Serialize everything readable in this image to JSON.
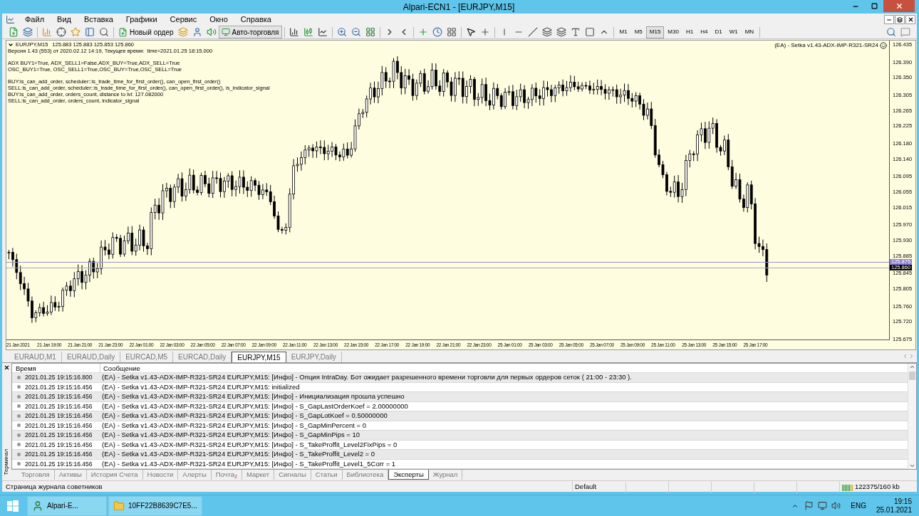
{
  "window": {
    "title": "Alpari-ECN1 - [EURJPY,M15]"
  },
  "menu": [
    "Файл",
    "Вид",
    "Вставка",
    "Графики",
    "Сервис",
    "Окно",
    "Справка"
  ],
  "toolbar": {
    "new_order": "Новый ордер",
    "auto_trading": "Авто-торговля",
    "timeframes": [
      {
        "label": "M1",
        "selected": false
      },
      {
        "label": "M5",
        "selected": false
      },
      {
        "label": "M15",
        "selected": true
      },
      {
        "label": "M30",
        "selected": false
      },
      {
        "label": "H1",
        "selected": false
      },
      {
        "label": "H4",
        "selected": false
      },
      {
        "label": "D1",
        "selected": false
      },
      {
        "label": "W1",
        "selected": false
      },
      {
        "label": "MN",
        "selected": false
      }
    ]
  },
  "chart": {
    "symbol": "EURJPY,M15",
    "ohlc": "125.883 125.883 125.853 125.860",
    "info_groups": [
      [
        "Версия 1.43 (553) от 2020.02.12 14:19, Текущее время:  time=2021.01.25 18:15.000"
      ],
      [
        "ADX BUY1=True, ADX_SELL1=False,ADX_BUY=True,ADX_SELL=True",
        "OSC_BUY1=True, OSC_SELL1=True,OSC_BUY=True,OSC_SELL=True"
      ],
      [
        "BUY:is_can_add_order, scheduler::is_trade_time_for_first_order(), can_open_first_order()",
        "SELL:is_can_add_order, scheduler::is_trade_time_for_first_order(), can_open_first_order(), is_indicator_signal",
        "BUY:is_can_add_order, orders_count, distance to lvl: 127.082000",
        "SELL:is_can_add_order, orders_count, indicator_signal"
      ]
    ],
    "expert": "(EA) - Setka v1.43-ADX-IMP-R321-SR24",
    "price_axis": [
      "126.435",
      "126.390",
      "126.350",
      "126.305",
      "126.265",
      "126.225",
      "126.180",
      "126.140",
      "126.095",
      "126.055",
      "126.015",
      "125.970",
      "125.930",
      "125.885",
      "125.845",
      "125.805",
      "125.760",
      "125.720",
      "125.675"
    ],
    "ask_label": "125.875",
    "bid_label": "125.860",
    "time_axis": [
      "21 Jan 2021",
      "21 Jan 19:00",
      "21 Jan 21:00",
      "21 Jan 23:00",
      "22 Jan 01:00",
      "22 Jan 03:00",
      "22 Jan 05:00",
      "22 Jan 07:00",
      "22 Jan 09:00",
      "22 Jan 11:00",
      "22 Jan 13:00",
      "22 Jan 15:00",
      "22 Jan 17:00",
      "22 Jan 19:00",
      "22 Jan 21:00",
      "22 Jan 23:00",
      "25 Jan 01:00",
      "25 Jan 03:00",
      "25 Jan 05:00",
      "25 Jan 07:00",
      "25 Jan 09:00",
      "25 Jan 11:00",
      "25 Jan 13:00",
      "25 Jan 15:00",
      "25 Jan 17:00"
    ]
  },
  "chart_tabs": [
    {
      "label": "EURAUD,M1",
      "selected": false
    },
    {
      "label": "EURAUD,Daily",
      "selected": false
    },
    {
      "label": "EURCAD,M5",
      "selected": false
    },
    {
      "label": "EURCAD,Daily",
      "selected": false
    },
    {
      "label": "EURJPY,M15",
      "selected": true
    },
    {
      "label": "EURJPY,Daily",
      "selected": false
    }
  ],
  "terminal": {
    "side_label": "Терминал",
    "columns": [
      "Время",
      "Сообщение"
    ],
    "rows": [
      {
        "time": "2021.01.25 19:15:16.800",
        "message": "(EA) - Setka v1.43-ADX-IMP-R321-SR24 EURJPY,M15: [Инфо] - Опция IntraDay. Бот ожидает разрешенного времени торговли для первых ордеров сеток ( 21:00 - 23:30 )."
      },
      {
        "time": "2021.01.25 19:15:16.456",
        "message": "(EA) - Setka v1.43-ADX-IMP-R321-SR24 EURJPY,M15: initialized"
      },
      {
        "time": "2021.01.25 19:15:16.456",
        "message": "(EA) - Setka v1.43-ADX-IMP-R321-SR24 EURJPY,M15: [Инфо] - Инициализация прошла успешно"
      },
      {
        "time": "2021.01.25 19:15:16.456",
        "message": "(EA) - Setka v1.43-ADX-IMP-R321-SR24 EURJPY,M15: [Инфо] - S_GapLastOrderKoef = 2.00000000"
      },
      {
        "time": "2021.01.25 19:15:16.456",
        "message": "(EA) - Setka v1.43-ADX-IMP-R321-SR24 EURJPY,M15: [Инфо] - S_GapLotKoef = 0.50000000"
      },
      {
        "time": "2021.01.25 19:15:16.456",
        "message": "(EA) - Setka v1.43-ADX-IMP-R321-SR24 EURJPY,M15: [Инфо] - S_GapMinPercent = 0"
      },
      {
        "time": "2021.01.25 19:15:16.456",
        "message": "(EA) - Setka v1.43-ADX-IMP-R321-SR24 EURJPY,M15: [Инфо] - S_GapMinPips = 10"
      },
      {
        "time": "2021.01.25 19:15:16.456",
        "message": "(EA) - Setka v1.43-ADX-IMP-R321-SR24 EURJPY,M15: [Инфо] - S_TakeProffit_Level2FixPips = 0"
      },
      {
        "time": "2021.01.25 19:15:16.456",
        "message": "(EA) - Setka v1.43-ADX-IMP-R321-SR24 EURJPY,M15: [Инфо] - S_TakeProffit_Level2 = 0"
      },
      {
        "time": "2021.01.25 19:15:16.456",
        "message": "(EA) - Setka v1.43-ADX-IMP-R321-SR24 EURJPY,M15: [Инфо] - S_TakeProffit_Level1_5Corr = 1"
      }
    ],
    "tabs": [
      {
        "label": "Торговля",
        "selected": false
      },
      {
        "label": "Активы",
        "selected": false
      },
      {
        "label": "История Счета",
        "selected": false
      },
      {
        "label": "Новости",
        "selected": false
      },
      {
        "label": "Алерты",
        "selected": false
      },
      {
        "label": "Почта",
        "badge": "2",
        "selected": false
      },
      {
        "label": "Маркет",
        "selected": false
      },
      {
        "label": "Сигналы",
        "selected": false
      },
      {
        "label": "Статьи",
        "selected": false
      },
      {
        "label": "Библиотека",
        "selected": false
      },
      {
        "label": "Эксперты",
        "selected": true
      },
      {
        "label": "Журнал",
        "selected": false
      }
    ]
  },
  "status_bar": {
    "text": "Страница журнала советников",
    "profile": "Default",
    "traffic": "122375/160 kb"
  },
  "taskbar": {
    "apps": [
      {
        "label": "Alpari-E..."
      },
      {
        "label": "10FF22B8639C7E5..."
      }
    ],
    "language": "ENG",
    "time": "19:15",
    "date": "25.01.2021"
  }
}
